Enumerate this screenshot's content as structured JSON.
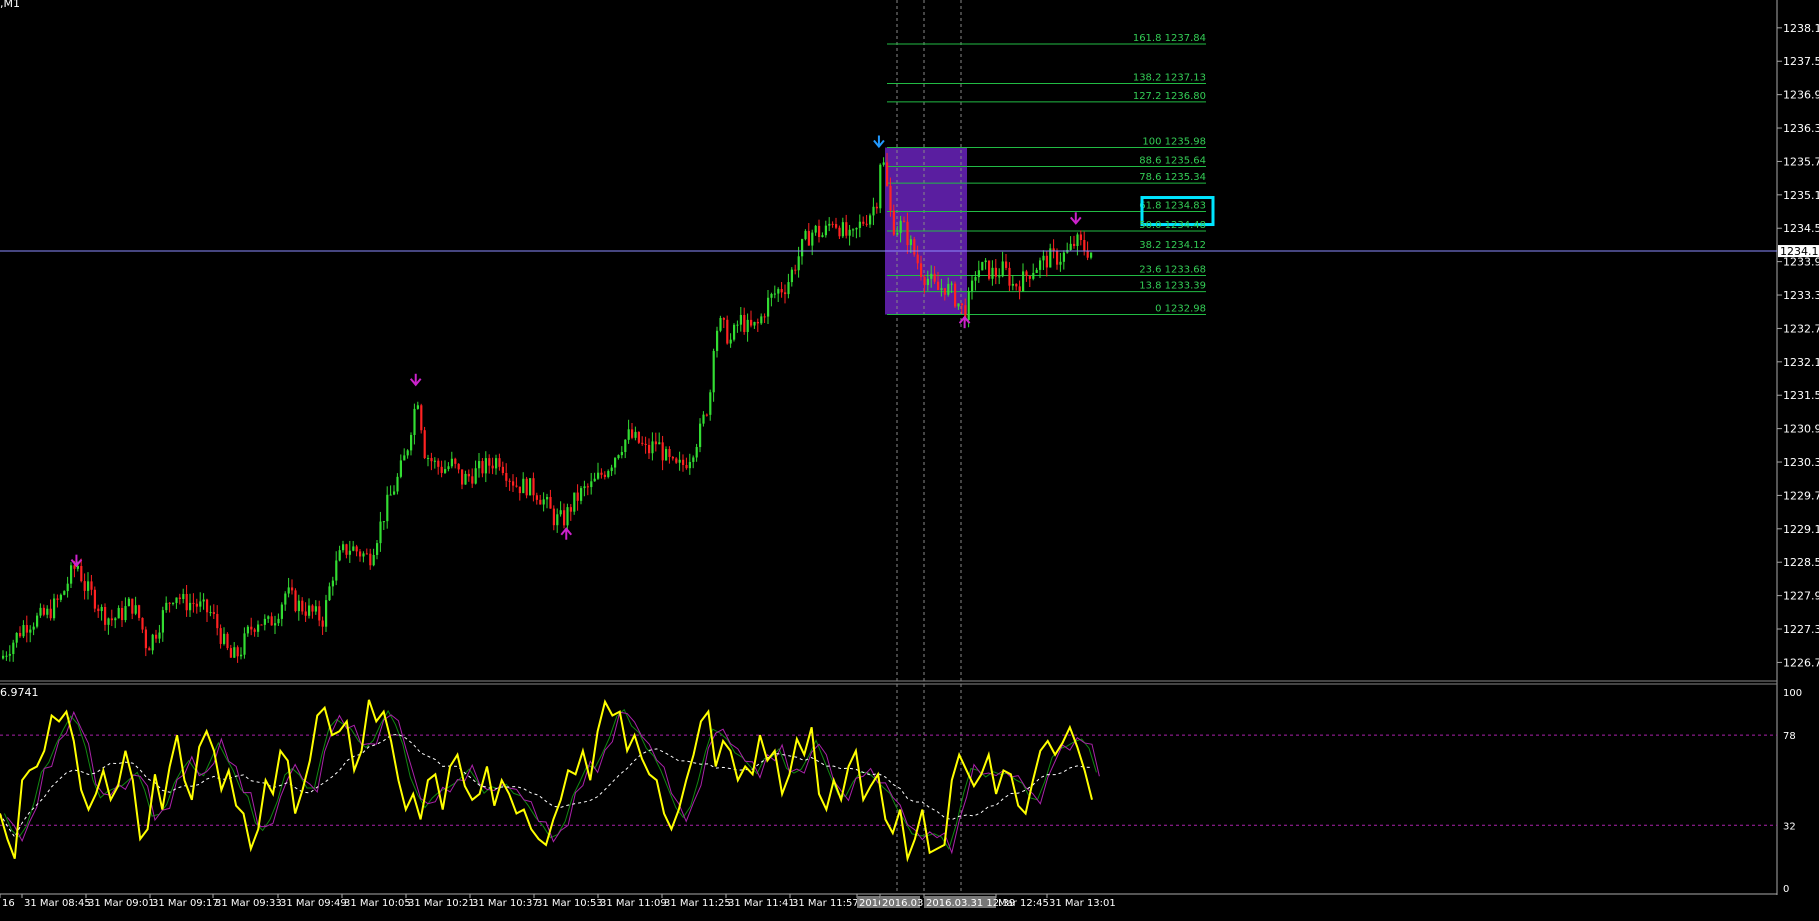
{
  "window": {
    "symbol_label": ",M1",
    "indicator_label": "6.9741"
  },
  "colors": {
    "background": "#000000",
    "bull_candle": "#33dd33",
    "bear_candle": "#ff2222",
    "fib_line": "#22bb44",
    "fib_text": "#33cc55",
    "zone_fill": "#5a1ea0",
    "current_price_line": "#8c8cff",
    "osc_main": "#ffff00",
    "osc_signal": "#ffffff",
    "osc_green": "#118811",
    "osc_purple": "#aa22aa",
    "osc_level": "#aa22aa",
    "arrow_purple": "#cc22cc",
    "arrow_blue": "#2299ff",
    "highlight_box": "#00e5ff"
  },
  "chart_data": [
    {
      "type": "candlestick",
      "title": "",
      "current_price": "1234.12",
      "ylim": [
        1226.45,
        1238.63
      ],
      "y_ticks": [
        "1238.13",
        "1237.53",
        "1236.93",
        "1236.33",
        "1235.73",
        "1235.13",
        "1234.53",
        "1233.93",
        "1233.33",
        "1232.73",
        "1232.13",
        "1231.53",
        "1230.93",
        "1230.33",
        "1229.73",
        "1229.13",
        "1228.53",
        "1227.93",
        "1227.33",
        "1226.73"
      ],
      "x_tick_labels": [
        "16",
        "31 Mar 08:45",
        "31 Mar 09:01",
        "31 Mar 09:17",
        "31 Mar 09:33",
        "31 Mar 09:49",
        "31 Mar 10:05",
        "31 Mar 10:21",
        "31 Mar 10:37",
        "31 Mar 10:53",
        "31 Mar 11:09",
        "31 Mar 11:25",
        "31 Mar 11:41",
        "31 Mar 11:57",
        "2016.",
        "2016.03",
        "2016.03.31 12:39",
        "Mar 12:45",
        "31 Mar 13:01"
      ],
      "close_path": [
        [
          0,
          1226.8
        ],
        [
          10,
          1227.1
        ],
        [
          20,
          1227.4
        ],
        [
          30,
          1227.5
        ],
        [
          40,
          1227.6
        ],
        [
          52,
          1227.9
        ],
        [
          60,
          1228.3
        ],
        [
          66,
          1228.5
        ],
        [
          72,
          1228.1
        ],
        [
          80,
          1227.9
        ],
        [
          88,
          1227.6
        ],
        [
          96,
          1227.5
        ],
        [
          104,
          1227.6
        ],
        [
          112,
          1227.8
        ],
        [
          120,
          1227.5
        ],
        [
          126,
          1227.0
        ],
        [
          134,
          1227.3
        ],
        [
          142,
          1227.7
        ],
        [
          150,
          1228.0
        ],
        [
          158,
          1227.8
        ],
        [
          166,
          1227.8
        ],
        [
          174,
          1227.7
        ],
        [
          182,
          1227.6
        ],
        [
          190,
          1227.2
        ],
        [
          198,
          1226.8
        ],
        [
          206,
          1226.9
        ],
        [
          214,
          1227.3
        ],
        [
          222,
          1227.5
        ],
        [
          230,
          1227.4
        ],
        [
          238,
          1227.6
        ],
        [
          246,
          1228.0
        ],
        [
          254,
          1227.8
        ],
        [
          262,
          1227.7
        ],
        [
          270,
          1227.6
        ],
        [
          278,
          1227.5
        ],
        [
          286,
          1228.3
        ],
        [
          294,
          1228.7
        ],
        [
          302,
          1228.8
        ],
        [
          310,
          1228.7
        ],
        [
          318,
          1228.6
        ],
        [
          326,
          1229.1
        ],
        [
          334,
          1229.6
        ],
        [
          342,
          1230.0
        ],
        [
          350,
          1230.5
        ],
        [
          356,
          1231.2
        ],
        [
          360,
          1231.5
        ],
        [
          366,
          1230.5
        ],
        [
          374,
          1230.3
        ],
        [
          382,
          1230.2
        ],
        [
          390,
          1230.3
        ],
        [
          398,
          1230.0
        ],
        [
          406,
          1230.1
        ],
        [
          414,
          1230.2
        ],
        [
          422,
          1230.3
        ],
        [
          430,
          1230.4
        ],
        [
          438,
          1230.1
        ],
        [
          446,
          1229.9
        ],
        [
          454,
          1229.9
        ],
        [
          462,
          1229.8
        ],
        [
          470,
          1229.6
        ],
        [
          478,
          1229.3
        ],
        [
          486,
          1229.3
        ],
        [
          494,
          1229.6
        ],
        [
          502,
          1229.8
        ],
        [
          510,
          1229.9
        ],
        [
          518,
          1230.1
        ],
        [
          526,
          1230.3
        ],
        [
          534,
          1230.6
        ],
        [
          542,
          1230.8
        ],
        [
          550,
          1230.7
        ],
        [
          558,
          1230.5
        ],
        [
          566,
          1230.7
        ],
        [
          574,
          1230.4
        ],
        [
          582,
          1230.2
        ],
        [
          590,
          1230.3
        ],
        [
          596,
          1230.5
        ],
        [
          604,
          1230.9
        ],
        [
          612,
          1231.5
        ],
        [
          616,
          1232.7
        ],
        [
          622,
          1232.8
        ],
        [
          630,
          1232.5
        ],
        [
          638,
          1232.9
        ],
        [
          646,
          1232.7
        ],
        [
          654,
          1232.8
        ],
        [
          662,
          1233.2
        ],
        [
          670,
          1233.4
        ],
        [
          678,
          1233.5
        ],
        [
          686,
          1233.9
        ],
        [
          694,
          1234.3
        ],
        [
          702,
          1234.5
        ],
        [
          710,
          1234.4
        ],
        [
          718,
          1234.7
        ],
        [
          726,
          1234.5
        ],
        [
          734,
          1234.3
        ],
        [
          742,
          1234.6
        ],
        [
          750,
          1234.8
        ],
        [
          756,
          1235.0
        ],
        [
          760,
          1235.95
        ],
        [
          764,
          1235.4
        ],
        [
          768,
          1234.8
        ],
        [
          772,
          1234.5
        ],
        [
          778,
          1234.6
        ],
        [
          784,
          1234.3
        ],
        [
          790,
          1234.0
        ],
        [
          796,
          1233.7
        ],
        [
          802,
          1233.6
        ],
        [
          808,
          1233.4
        ],
        [
          814,
          1233.5
        ],
        [
          820,
          1233.4
        ],
        [
          826,
          1233.2
        ],
        [
          832,
          1233.0
        ],
        [
          838,
          1233.4
        ],
        [
          842,
          1233.8
        ],
        [
          850,
          1233.8
        ],
        [
          858,
          1233.7
        ],
        [
          866,
          1233.8
        ],
        [
          874,
          1233.5
        ],
        [
          882,
          1233.6
        ],
        [
          890,
          1233.8
        ],
        [
          898,
          1233.9
        ],
        [
          906,
          1234.0
        ],
        [
          914,
          1234.0
        ],
        [
          922,
          1234.1
        ],
        [
          928,
          1234.3
        ],
        [
          934,
          1234.2
        ],
        [
          940,
          1234.1
        ]
      ],
      "fibonacci": [
        {
          "level": "161.8",
          "price": "1237.84"
        },
        {
          "level": "138.2",
          "price": "1237.13"
        },
        {
          "level": "127.2",
          "price": "1236.80"
        },
        {
          "level": "100",
          "price": "1235.98"
        },
        {
          "level": "88.6",
          "price": "1235.64"
        },
        {
          "level": "78.6",
          "price": "1235.34"
        },
        {
          "level": "61.8",
          "price": "1234.83",
          "highlight": true
        },
        {
          "level": "50.0",
          "price": "1234.48"
        },
        {
          "level": "38.2",
          "price": "1234.12"
        },
        {
          "level": "23.6",
          "price": "1233.68"
        },
        {
          "level": "13.8",
          "price": "1233.39"
        },
        {
          "level": "0",
          "price": "1232.98"
        }
      ],
      "fib_zone": {
        "from_price": 1232.98,
        "to_price": 1235.98
      },
      "arrows": [
        {
          "x": 66,
          "price": 1228.45,
          "dir": "down",
          "color": "purple"
        },
        {
          "x": 359,
          "price": 1231.7,
          "dir": "down",
          "color": "purple"
        },
        {
          "x": 489,
          "price": 1229.15,
          "dir": "up",
          "color": "purple"
        },
        {
          "x": 759,
          "price": 1235.98,
          "dir": "down",
          "color": "blue"
        },
        {
          "x": 833,
          "price": 1232.95,
          "dir": "up",
          "color": "purple"
        },
        {
          "x": 929,
          "price": 1234.6,
          "dir": "down",
          "color": "purple"
        }
      ]
    },
    {
      "type": "line",
      "title": "",
      "ylim": [
        0,
        100
      ],
      "y_ticks": [
        "100",
        "78",
        "32",
        "0"
      ],
      "levels": [
        78,
        32
      ],
      "series": [
        {
          "role": "main",
          "values": [
            38,
            25,
            15,
            55,
            60,
            62,
            70,
            88,
            85,
            90,
            75,
            50,
            40,
            48,
            60,
            45,
            52,
            70,
            55,
            25,
            30,
            58,
            40,
            62,
            78,
            55,
            45,
            72,
            80,
            70,
            50,
            60,
            42,
            38,
            20,
            30,
            55,
            48,
            70,
            65,
            38,
            50,
            65,
            88,
            92,
            78,
            80,
            85,
            60,
            70,
            96,
            85,
            90,
            75,
            55,
            40,
            48,
            35,
            55,
            58,
            40,
            62,
            68,
            52,
            45,
            48,
            62,
            42,
            55,
            48,
            38,
            40,
            30,
            25,
            22,
            35,
            45,
            60,
            58,
            70,
            55,
            80,
            95,
            88,
            90,
            70,
            78,
            66,
            58,
            55,
            38,
            30,
            40,
            55,
            68,
            85,
            90,
            62,
            75,
            70,
            55,
            62,
            58,
            78,
            65,
            70,
            48,
            58,
            76,
            68,
            82,
            48,
            40,
            55,
            45,
            62,
            70,
            45,
            52,
            58,
            35,
            28,
            40,
            15,
            25,
            40,
            18,
            20,
            22,
            55,
            68,
            60,
            52,
            58,
            68,
            48,
            60,
            58,
            42,
            38,
            55,
            70,
            75,
            68,
            74,
            82,
            72,
            60,
            45
          ]
        }
      ]
    }
  ]
}
